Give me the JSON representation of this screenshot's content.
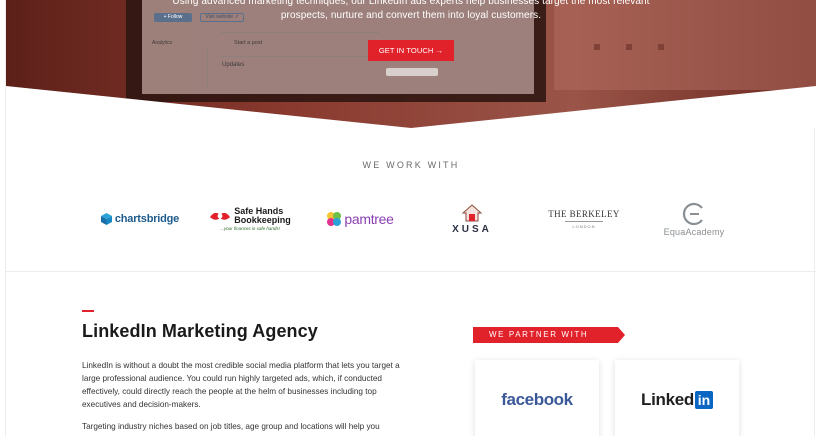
{
  "hero": {
    "intro_line1": "Using advanced marketing techniques, our LinkedIn ads experts help businesses target the most relevant",
    "intro_line2": "prospects, nurture and convert them into loyal customers.",
    "cta_label": "GET IN TOUCH →",
    "colors": {
      "overlay": "#7a2a22",
      "accent": "#e2222b"
    },
    "mock_screen": {
      "follow_label": "+ Follow",
      "visit_label": "Visit website ↗",
      "analytics_label": "Analytics",
      "start_post_label": "Start a post",
      "updates_label": "Updates"
    }
  },
  "clients": {
    "heading": "WE WORK WITH",
    "logos": [
      {
        "name": "chartsbridge",
        "text": "chartsbridge",
        "icon": "cube-icon"
      },
      {
        "name": "safe-hands",
        "text": "Safe Hands",
        "text2": "Bookkeeping",
        "tagline": "...your finances in safe hands!"
      },
      {
        "name": "pamtree",
        "text": "pamtree"
      },
      {
        "name": "xusa",
        "text": "XUSA",
        "icon": "house-icon"
      },
      {
        "name": "the-berkeley",
        "text": "THE BERKELEY",
        "sub": "LONDON"
      },
      {
        "name": "equaacademy",
        "text": "EquaAcademy",
        "icon": "ring-icon"
      }
    ]
  },
  "about": {
    "heading": "LinkedIn Marketing Agency",
    "para1_lines": [
      "LinkedIn is without a doubt the most credible social media platform that lets you target a",
      "large professional audience. You could run highly targeted ads, which, if conducted",
      "effectively, could directly reach the people at the helm of businesses including top",
      "executives and decision-makers."
    ],
    "para2_lines": [
      "Targeting industry niches based on job titles, age group and locations will help you"
    ]
  },
  "partners": {
    "label": "WE PARTNER WITH",
    "cards": [
      {
        "name": "facebook",
        "text": "facebook"
      },
      {
        "name": "linkedin",
        "text": "Linked",
        "box": "in"
      }
    ]
  }
}
